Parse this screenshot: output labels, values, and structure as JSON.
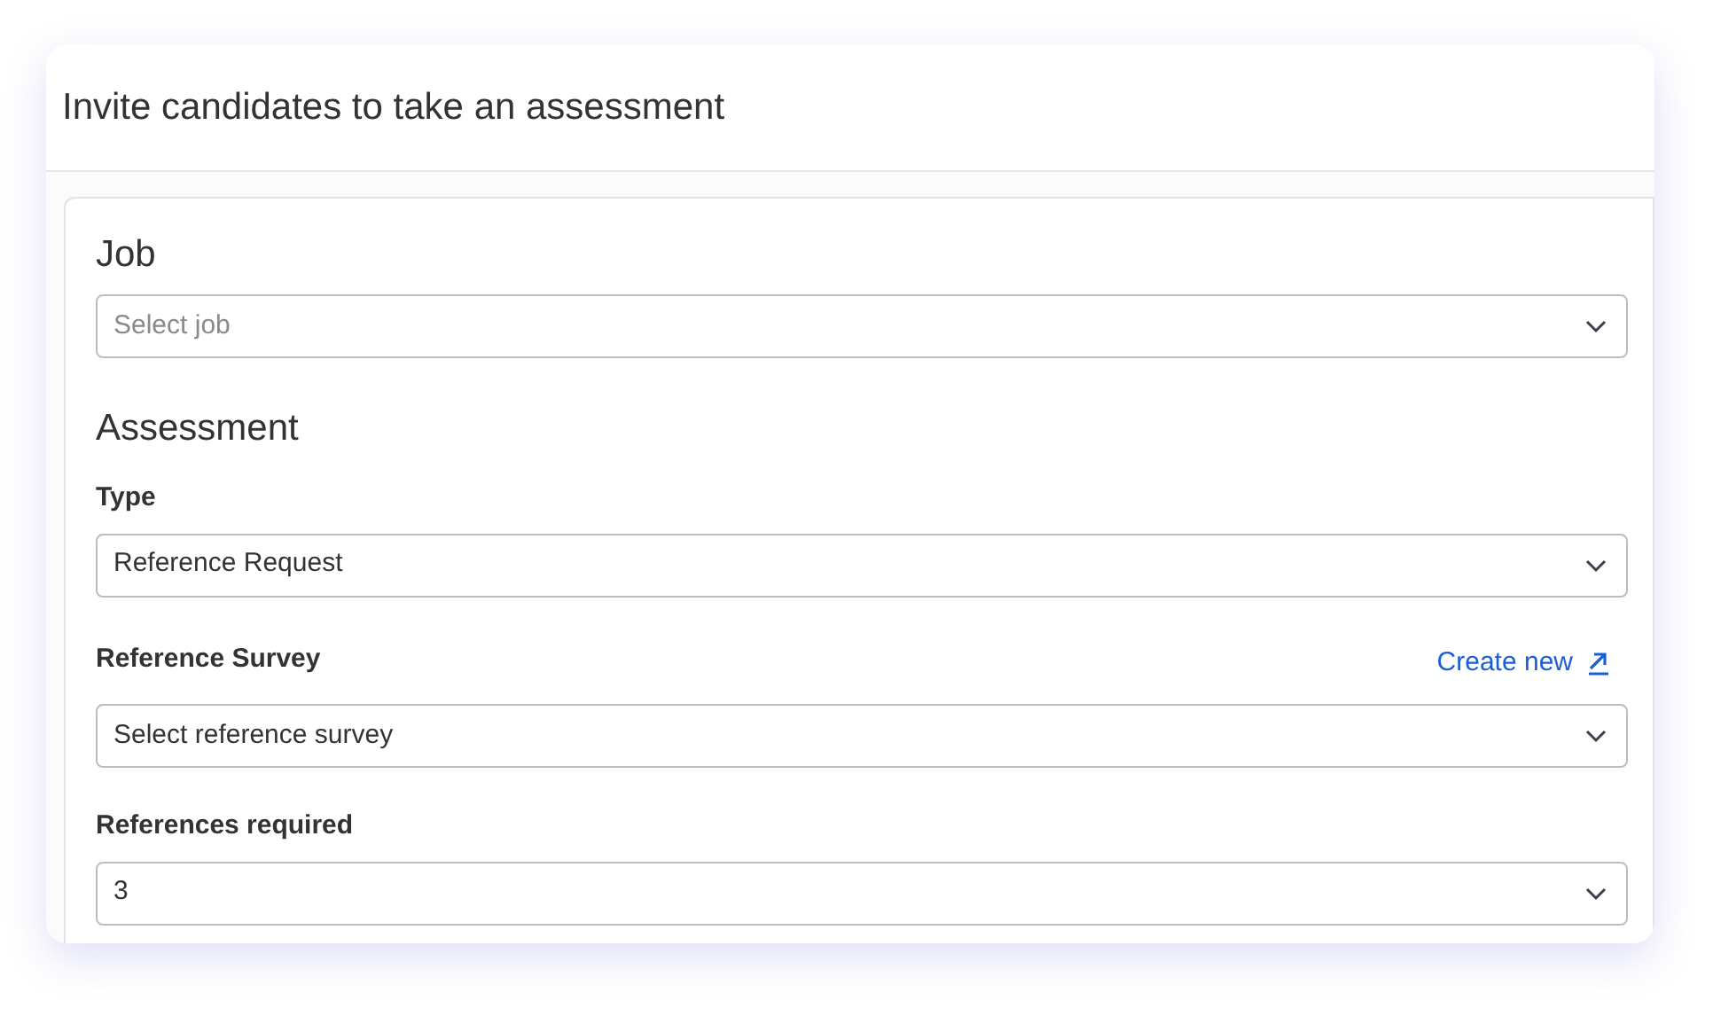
{
  "title": "Invite candidates to take an assessment",
  "sections": [
    {
      "heading": "Job",
      "fields": [
        {
          "select": {
            "placeholder": "Select job"
          }
        }
      ]
    },
    {
      "heading": "Assessment",
      "fields": [
        {
          "label": "Type",
          "select": {
            "value": "Reference Request"
          }
        },
        {
          "label": "Reference Survey",
          "link": "Create new",
          "select": {
            "value": "Select reference survey"
          }
        },
        {
          "label": "References required",
          "select": {
            "value": "3"
          }
        }
      ]
    }
  ]
}
